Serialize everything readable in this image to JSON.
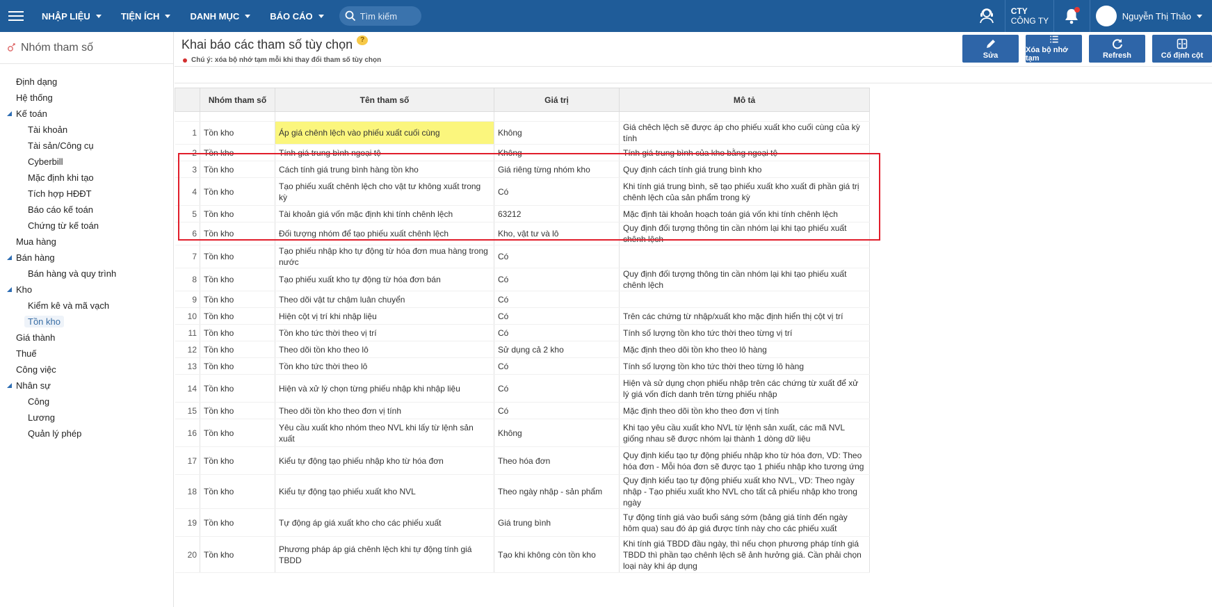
{
  "nav": {
    "menus": [
      {
        "label": "NHẬP LIỆU"
      },
      {
        "label": "TIỆN ÍCH"
      },
      {
        "label": "DANH MỤC"
      },
      {
        "label": "BÁO CÁO"
      }
    ],
    "search_placeholder": "Tìm kiếm",
    "company_line1": "CTY",
    "company_line2": "CÔNG TY",
    "user_name": "Nguyễn Thị Thảo",
    "icons": {
      "menu": "hamburger-icon",
      "search": "search-icon",
      "support": "support-agent-icon",
      "bell": "bell-icon",
      "avatar": "avatar"
    }
  },
  "sidebar": {
    "title": "Nhóm tham số",
    "items": [
      {
        "label": "Định dạng"
      },
      {
        "label": "Hệ thống"
      },
      {
        "label": "Kế toán"
      },
      {
        "label": "Tài khoản"
      },
      {
        "label": "Tài sản/Công cụ"
      },
      {
        "label": "Cyberbill"
      },
      {
        "label": "Mặc định khi tạo"
      },
      {
        "label": "Tích hợp HĐĐT"
      },
      {
        "label": "Báo cáo kế toán"
      },
      {
        "label": "Chứng từ kế toán"
      },
      {
        "label": "Mua hàng"
      },
      {
        "label": "Bán hàng"
      },
      {
        "label": "Bán hàng và quy trình"
      },
      {
        "label": "Kho"
      },
      {
        "label": "Kiểm kê và mã vạch"
      },
      {
        "label": "Tồn kho"
      },
      {
        "label": "Giá thành"
      },
      {
        "label": "Thuế"
      },
      {
        "label": "Công việc"
      },
      {
        "label": "Nhân sự"
      },
      {
        "label": "Công"
      },
      {
        "label": "Lương"
      },
      {
        "label": "Quản lý phép"
      }
    ]
  },
  "page": {
    "title": "Khai báo các tham số tùy chọn",
    "help": "?",
    "note": "Chú ý: xóa bộ nhớ tạm mỗi khi thay đổi tham số tùy chọn",
    "toolbar": [
      {
        "label": "Sửa",
        "icon": "pencil-icon"
      },
      {
        "label": "Xóa bộ nhớ tạm",
        "icon": "list-icon"
      },
      {
        "label": "Refresh",
        "icon": "refresh-icon"
      },
      {
        "label": "Cố định cột",
        "icon": "freeze-columns-icon"
      }
    ]
  },
  "table": {
    "headers": {
      "group": "Nhóm tham số",
      "name": "Tên tham số",
      "value": "Giá trị",
      "desc": "Mô tả"
    },
    "rows": [
      {
        "no": "1",
        "group": "Tồn kho",
        "name": "Áp giá chênh lệch vào phiếu xuất cuối cùng",
        "value": "Không",
        "desc": "Giá chêch lệch sẽ được áp cho phiếu xuất kho cuối cùng của kỳ tính"
      },
      {
        "no": "2",
        "group": "Tồn kho",
        "name": "Tính giá trung bình ngoại tệ",
        "value": "Không",
        "desc": "Tính giá trung bình của kho bằng ngoại tệ"
      },
      {
        "no": "3",
        "group": "Tồn kho",
        "name": "Cách tính giá trung bình hàng tồn kho",
        "value": "Giá riêng từng nhóm kho",
        "desc": "Quy định cách tính giá trung bình kho"
      },
      {
        "no": "4",
        "group": "Tồn kho",
        "name": "Tạo phiếu xuất chênh lệch cho vật tư không xuất trong kỳ",
        "value": "Có",
        "desc": "Khi tính giá trung bình, sẽ tạo phiếu xuất kho xuất đi phần giá trị chênh lệch của sản phẩm trong kỳ"
      },
      {
        "no": "5",
        "group": "Tồn kho",
        "name": "Tài khoản giá vốn mặc định khi tính chênh lệch",
        "value": "63212",
        "desc": "Mặc định tài khoản hoạch toán giá vốn khi tính chênh lệch"
      },
      {
        "no": "6",
        "group": "Tồn kho",
        "name": "Đối tượng nhóm để tạo phiếu xuất chênh lệch",
        "value": "Kho, vật tư và lô",
        "desc": "Quy định đối tượng thông tin cần nhóm lại khi tạo phiếu xuất chênh lệch"
      },
      {
        "no": "7",
        "group": "Tồn kho",
        "name": "Tạo phiếu nhập kho tự động từ hóa đơn mua hàng trong nước",
        "value": "Có",
        "desc": ""
      },
      {
        "no": "8",
        "group": "Tồn kho",
        "name": "Tạo phiếu xuất kho tự động từ hóa đơn bán",
        "value": "Có",
        "desc": "Quy định đối tượng thông tin cần nhóm lại khi tạo phiếu xuất chênh lệch"
      },
      {
        "no": "9",
        "group": "Tồn kho",
        "name": "Theo dõi vật tư chậm luân chuyển",
        "value": "Có",
        "desc": ""
      },
      {
        "no": "10",
        "group": "Tồn kho",
        "name": "Hiện cột vị trí khi nhập liệu",
        "value": "Có",
        "desc": "Trên các chứng từ nhập/xuất kho mặc định hiển thị cột vị trí"
      },
      {
        "no": "11",
        "group": "Tồn kho",
        "name": "Tồn kho tức thời theo vị trí",
        "value": "Có",
        "desc": "Tính số lượng tồn kho tức thời theo từng vị trí"
      },
      {
        "no": "12",
        "group": "Tồn kho",
        "name": "Theo dõi tồn kho theo lô",
        "value": "Sử dụng cả 2 kho",
        "desc": "Mặc định theo dõi tồn kho theo lô hàng"
      },
      {
        "no": "13",
        "group": "Tồn kho",
        "name": "Tồn kho tức thời theo lô",
        "value": "Có",
        "desc": "Tính số lượng tồn kho tức thời theo từng lô hàng"
      },
      {
        "no": "14",
        "group": "Tồn kho",
        "name": "Hiện và xử lý chọn từng phiếu nhập khi nhập liệu",
        "value": "Có",
        "desc": "Hiện và sử dụng chọn phiếu nhập trên các chứng từ xuất để xử lý giá vốn đích danh trên từng phiếu nhập"
      },
      {
        "no": "15",
        "group": "Tồn kho",
        "name": "Theo dõi tồn kho theo đơn vị tính",
        "value": "Có",
        "desc": "Mặc định theo dõi tồn kho theo đơn vị tính"
      },
      {
        "no": "16",
        "group": "Tồn kho",
        "name": "Yêu cầu xuất kho nhóm theo NVL khi lấy từ lệnh sản xuất",
        "value": "Không",
        "desc": "Khi tạo yêu cầu xuất kho NVL từ lệnh sản xuất, các mã NVL giống nhau sẽ được nhóm lại thành 1 dòng dữ liệu"
      },
      {
        "no": "17",
        "group": "Tồn kho",
        "name": "Kiểu tự động tạo phiếu nhập kho từ hóa đơn",
        "value": "Theo hóa đơn",
        "desc": "Quy định kiểu tạo tự động phiếu nhập kho từ hóa đơn, VD: Theo hóa đơn - Mỗi hóa đơn sẽ được tạo 1 phiếu nhập kho tương ứng"
      },
      {
        "no": "18",
        "group": "Tồn kho",
        "name": "Kiểu tự động tạo phiếu xuất kho NVL",
        "value": "Theo ngày nhập - sản phẩm",
        "desc": "Quy định kiểu tạo tự động phiếu xuất kho NVL, VD: Theo ngày nhập - Tạo phiếu xuất kho NVL cho tất cả phiếu nhập kho trong ngày"
      },
      {
        "no": "19",
        "group": "Tồn kho",
        "name": "Tự động áp giá xuất kho cho các phiếu xuất",
        "value": "Giá trung bình",
        "desc": "Tự động tính giá vào buổi sáng sớm (bảng giá tính đến ngày hôm qua) sau đó áp giá được tính này cho các phiếu xuất"
      },
      {
        "no": "20",
        "group": "Tồn kho",
        "name": "Phương pháp áp giá chênh lệch khi tự động tính giá TBDD",
        "value": "Tạo khi không còn tồn kho",
        "desc": "Khi tính giá TBDD đầu ngày, thì nếu chọn phương pháp tính giá TBDD thì phần tạo chênh lệch sẽ ảnh hưởng giá. Cần phải chọn loại này khi áp dụng"
      }
    ]
  },
  "highlight_color": "#fbf67d",
  "annotation_color": "#e11d2a"
}
